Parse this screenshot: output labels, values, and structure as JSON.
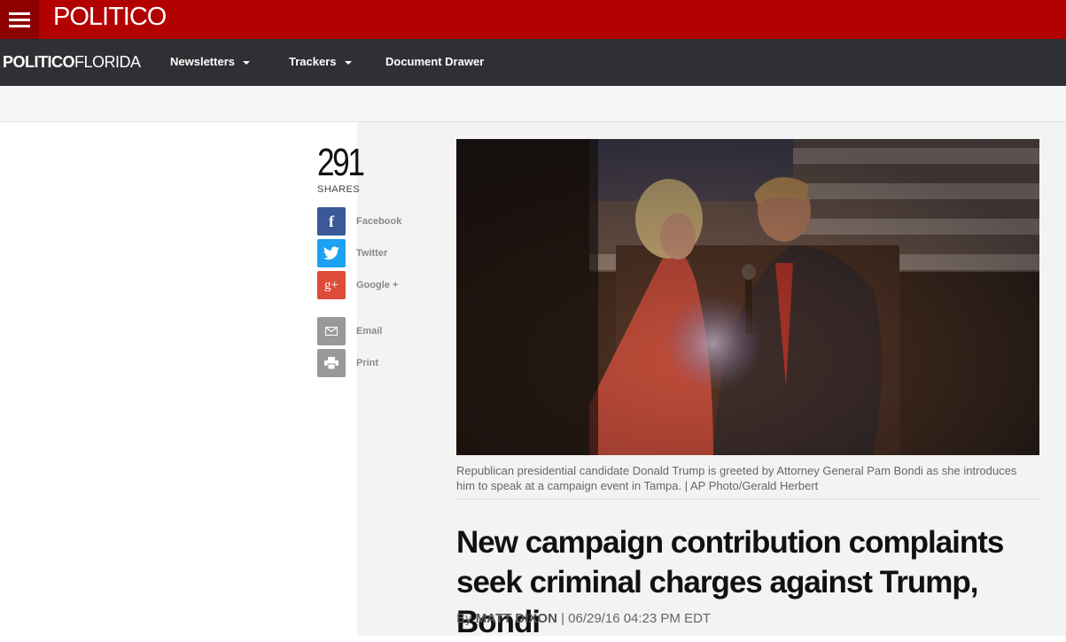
{
  "header": {
    "logo": "POLITICO",
    "site_brand_bold": "POLITICO",
    "site_brand_thin": "FLORIDA",
    "nav": [
      {
        "label": "Newsletters"
      },
      {
        "label": "Trackers"
      },
      {
        "label": "Document Drawer"
      }
    ]
  },
  "share": {
    "count": "291",
    "label": "SHARES",
    "items": [
      {
        "label": "Facebook",
        "icon": "facebook-icon",
        "color": "#3b5998"
      },
      {
        "label": "Twitter",
        "icon": "twitter-icon",
        "color": "#1da1f2"
      },
      {
        "label": "Google +",
        "icon": "google-plus-icon",
        "color": "#dd4b39"
      },
      {
        "label": "Email",
        "icon": "email-icon",
        "color": "#999999"
      },
      {
        "label": "Print",
        "icon": "print-icon",
        "color": "#999999"
      }
    ]
  },
  "article": {
    "caption": "Republican presidential candidate Donald Trump is greeted by Attorney General Pam Bondi as she introduces him to speak at a campaign event in Tampa. | AP Photo/Gerald Herbert",
    "headline": "New campaign contribution complaints seek criminal charges against Trump, Bondi",
    "by": "By",
    "author": "MATT DIXON",
    "timestamp": "| 06/29/16 04:23 PM EDT"
  },
  "colors": {
    "brand_red": "#b30000",
    "nav_dark": "#2f3034"
  }
}
